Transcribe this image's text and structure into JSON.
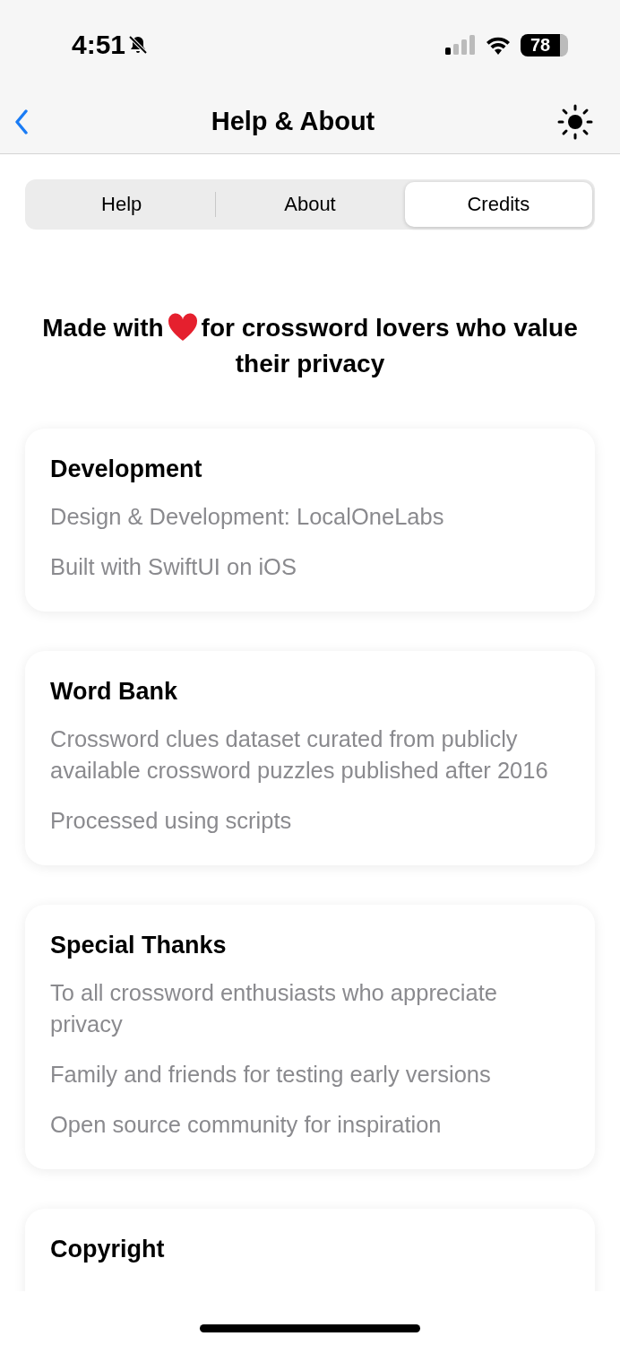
{
  "status_bar": {
    "time": "4:51",
    "silent": true,
    "battery": "78"
  },
  "nav": {
    "title": "Help & About"
  },
  "tabs": [
    {
      "label": "Help",
      "selected": false
    },
    {
      "label": "About",
      "selected": false
    },
    {
      "label": "Credits",
      "selected": true
    }
  ],
  "tagline": {
    "before": "Made with",
    "after": "for crossword lovers who value their privacy"
  },
  "sections": [
    {
      "title": "Development",
      "lines": [
        "Design & Development: LocalOneLabs",
        "Built with SwiftUI on iOS"
      ]
    },
    {
      "title": "Word Bank",
      "lines": [
        "Crossword clues dataset curated from publicly available crossword puzzles published after 2016",
        "Processed using scripts"
      ]
    },
    {
      "title": "Special Thanks",
      "lines": [
        "To all crossword enthusiasts who appreciate privacy",
        "Family and friends for testing early versions",
        "Open source community for inspiration"
      ]
    },
    {
      "title": "Copyright"
    }
  ]
}
